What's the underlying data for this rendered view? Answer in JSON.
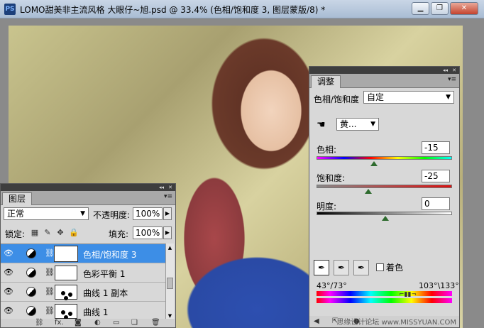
{
  "window": {
    "app_icon": "PS",
    "title": "LOMO甜美非主流风格  大眼仔~旭.psd @ 33.4% (色相/饱和度 3, 图层蒙版/8) *",
    "buttons": [
      "minimize-icon",
      "restore-icon",
      "close-icon"
    ]
  },
  "layers_panel": {
    "tab": "图层",
    "blend_mode": "正常",
    "opacity_label": "不透明度:",
    "opacity_value": "100%",
    "lock_label": "锁定:",
    "fill_label": "填充:",
    "fill_value": "100%",
    "layers": [
      {
        "name": "色相/饱和度 3",
        "selected": true
      },
      {
        "name": "色彩平衡 1",
        "selected": false
      },
      {
        "name": "曲线 1 副本",
        "selected": false
      },
      {
        "name": "曲线 1",
        "selected": false
      }
    ],
    "footer_icons": [
      "link-icon",
      "fx-icon",
      "mask-icon",
      "adjustment-icon",
      "folder-icon",
      "new-layer-icon",
      "trash-icon"
    ],
    "footer_fx": "fx."
  },
  "adjust_panel": {
    "tab": "调整",
    "type": "色相/饱和度",
    "preset": "自定",
    "channel": "黄...",
    "hue_label": "色相:",
    "hue_value": "-15",
    "sat_label": "饱和度:",
    "sat_value": "-25",
    "light_label": "明度:",
    "light_value": "0",
    "colorize_label": "着色",
    "range_left": "43°/73°",
    "range_right": "103°\\133°",
    "watermark": "思缘设计论坛 www.MISSYUAN.COM"
  }
}
